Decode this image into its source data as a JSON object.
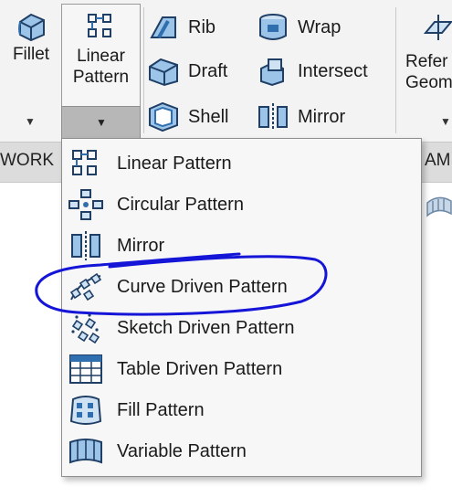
{
  "ribbon": {
    "fillet_label": "Fillet",
    "linear_pattern_label_line1": "Linear",
    "linear_pattern_label_line2": "Pattern",
    "rib_label": "Rib",
    "draft_label": "Draft",
    "shell_label": "Shell",
    "wrap_label": "Wrap",
    "intersect_label": "Intersect",
    "mirror_label": "Mirror",
    "reference_geometry_label_line1": "Refer",
    "reference_geometry_label_line2": "Geom",
    "dropdown_arrow": "▼"
  },
  "tabs": {
    "left_partial": "WORK",
    "right_partial": "AM"
  },
  "menu": {
    "items": [
      {
        "label": "Linear Pattern",
        "icon": "linear-pattern-icon"
      },
      {
        "label": "Circular Pattern",
        "icon": "circular-pattern-icon"
      },
      {
        "label": "Mirror",
        "icon": "mirror-icon"
      },
      {
        "label": "Curve Driven Pattern",
        "icon": "curve-driven-pattern-icon",
        "highlighted": true
      },
      {
        "label": "Sketch Driven Pattern",
        "icon": "sketch-driven-pattern-icon"
      },
      {
        "label": "Table Driven Pattern",
        "icon": "table-driven-pattern-icon"
      },
      {
        "label": "Fill Pattern",
        "icon": "fill-pattern-icon"
      },
      {
        "label": "Variable Pattern",
        "icon": "variable-pattern-icon"
      }
    ]
  },
  "colors": {
    "annotation_circle": "#1515d8",
    "icon_blue": "#2f6fb0",
    "icon_dark": "#1f3f66"
  }
}
